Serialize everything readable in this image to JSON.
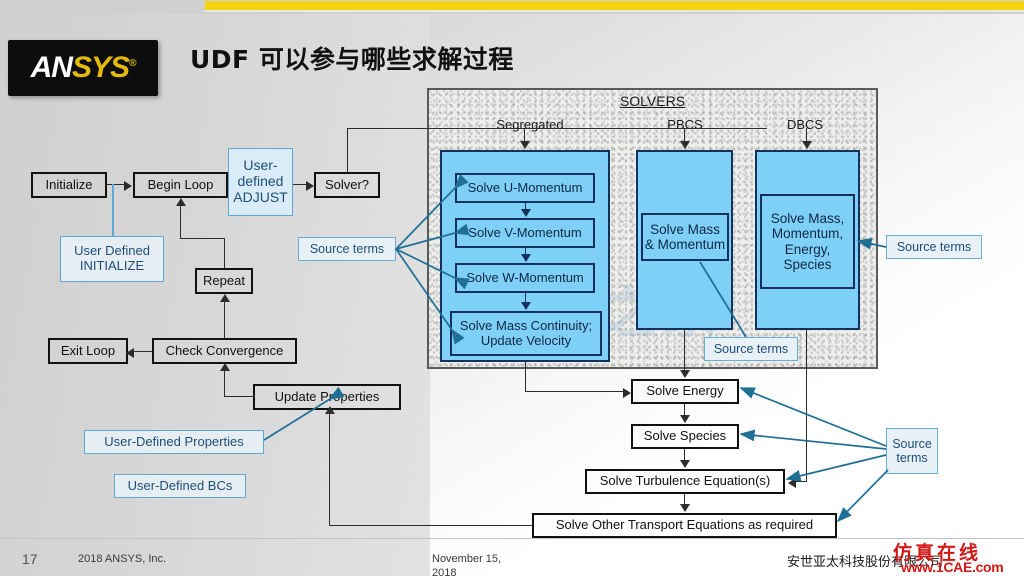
{
  "slide": {
    "title": "UDF 可以参与哪些求解过程",
    "logo": {
      "part1": "AN",
      "part2": "SYS",
      "registered": "®"
    },
    "accent_yellow": "#f5d310",
    "udf_blue": "#1d4e7a",
    "solver_fill": "#7fd0f7"
  },
  "flow_left": {
    "initialize": "Initialize",
    "begin_loop": "Begin Loop",
    "user_defined_adjust": "User-\ndefined\nADJUST",
    "solver_q": "Solver?",
    "user_defined_initialize": "User Defined\nINITIALIZE",
    "repeat": "Repeat",
    "exit_loop": "Exit Loop",
    "check_convergence": "Check Convergence",
    "update_properties": "Update Properties",
    "user_defined_properties": "User-Defined Properties",
    "user_defined_bcs": "User-Defined BCs"
  },
  "solvers_panel": {
    "title": "SOLVERS",
    "columns": [
      {
        "label": "Segregated"
      },
      {
        "label": "PBCS"
      },
      {
        "label": "DBCS"
      }
    ],
    "segregated_steps": [
      "Solve U-Momentum",
      "Solve V-Momentum",
      "Solve W-Momentum",
      "Solve Mass Continuity;\nUpdate Velocity"
    ],
    "pbcs_step": "Solve Mass\n& Momentum",
    "dbcs_step": "Solve Mass,\nMomentum,\nEnergy,\nSpecies"
  },
  "flow_bottom": {
    "solve_energy": "Solve Energy",
    "solve_species": "Solve Species",
    "solve_turbulence": "Solve Turbulence Equation(s)",
    "solve_other": "Solve Other Transport Equations as required"
  },
  "source_terms": {
    "left": "Source terms",
    "mid": "Source terms",
    "right": "Source terms",
    "bottom": "Source\nterms"
  },
  "watermark": {
    "faint": "CAE之家",
    "red_cn": "仿真在线",
    "red_url": "www.1CAE.com"
  },
  "footer": {
    "page_number": "17",
    "copyright": "2018  ANSYS, Inc.",
    "date": "November 15,\n2018",
    "company_cn": "安世亚太科技股份有限公司"
  }
}
